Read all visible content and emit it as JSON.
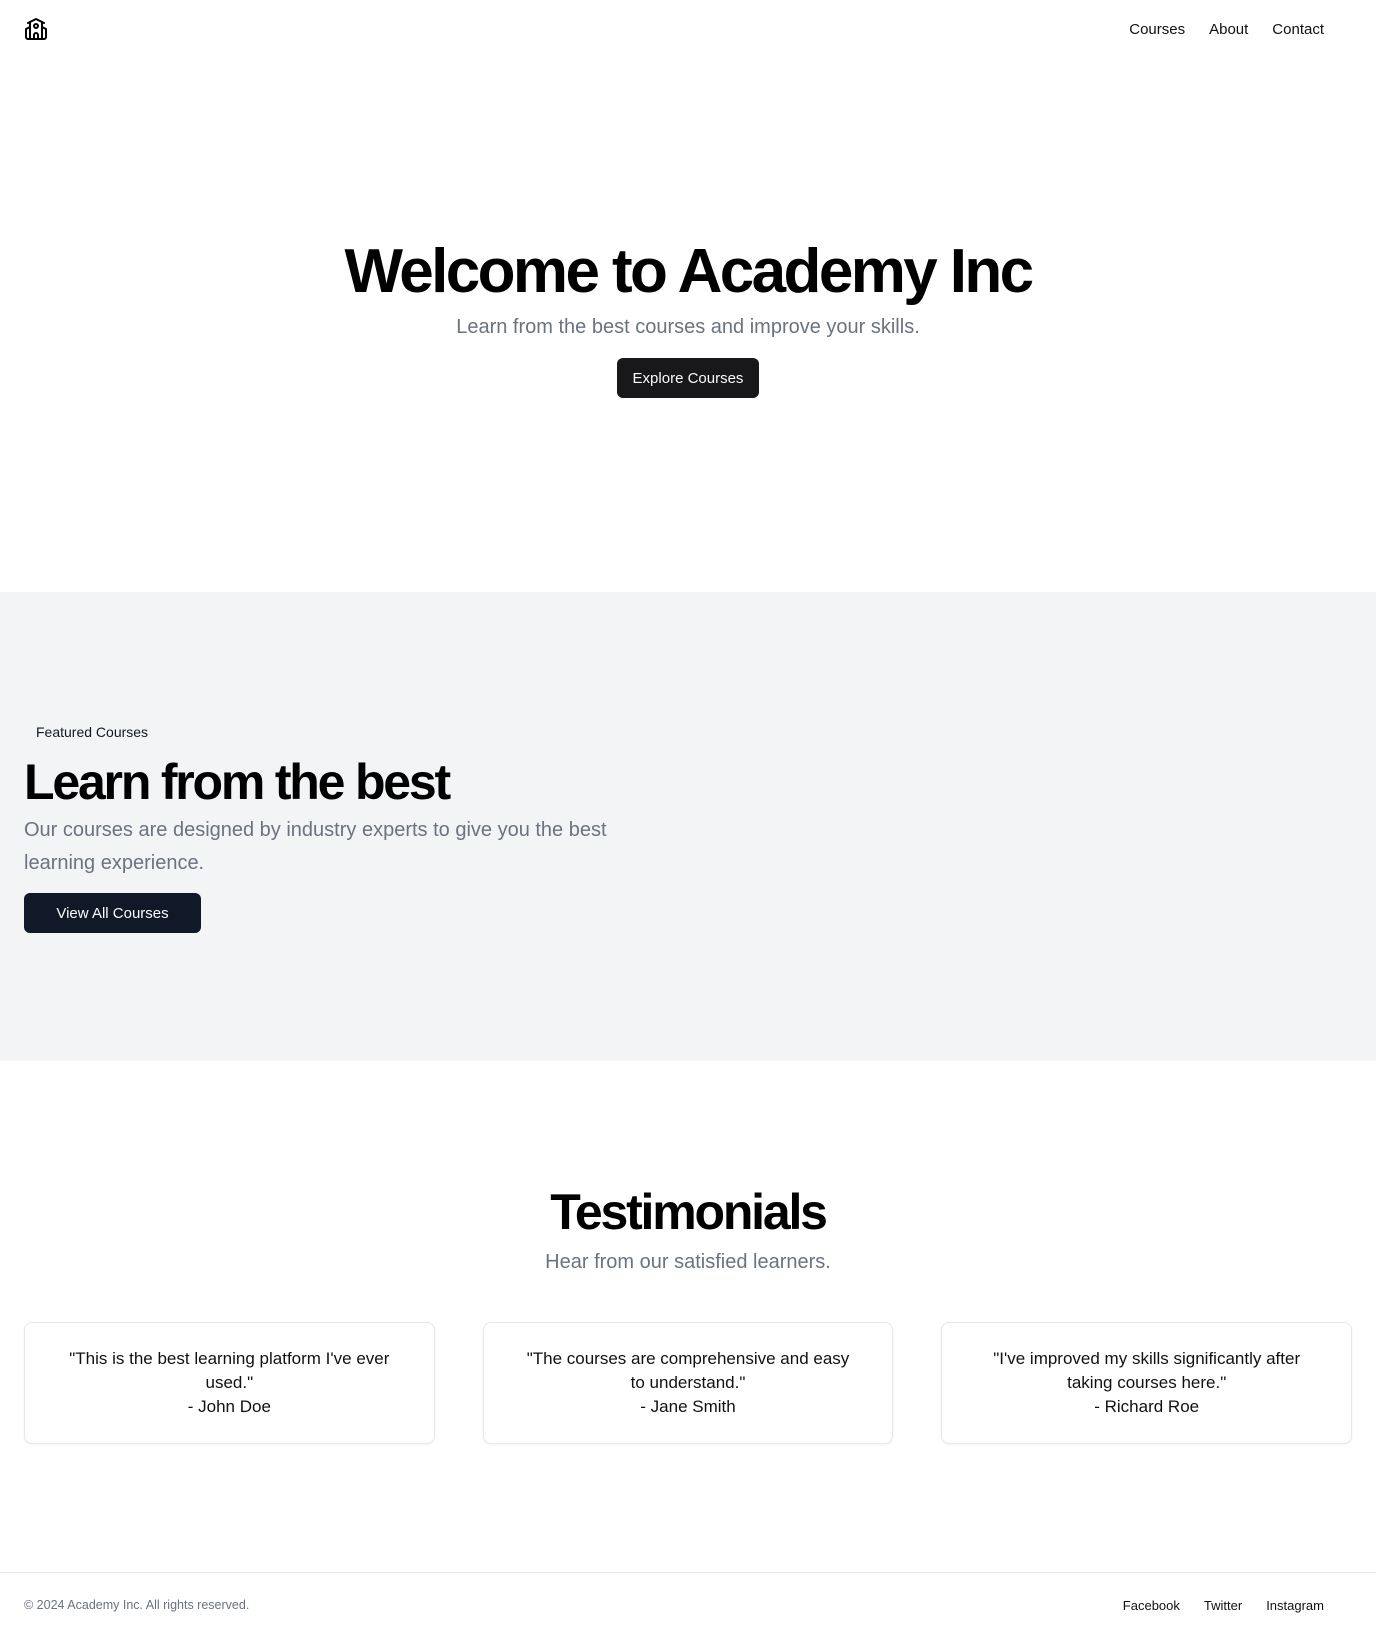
{
  "header": {
    "logo_icon": "school-building-icon",
    "nav": [
      {
        "label": "Courses"
      },
      {
        "label": "About"
      },
      {
        "label": "Contact"
      }
    ]
  },
  "hero": {
    "title": "Welcome to Academy Inc",
    "subtitle": "Learn from the best courses and improve your skills.",
    "cta_label": "Explore Courses"
  },
  "featured": {
    "badge": "Featured Courses",
    "title": "Learn from the best",
    "description": "Our courses are designed by industry experts to give you the best learning experience.",
    "cta_label": "View All Courses"
  },
  "testimonials": {
    "title": "Testimonials",
    "subtitle": "Hear from our satisfied learners.",
    "items": [
      {
        "quote": "\"This is the best learning platform I've ever used.\"",
        "author": "- John Doe"
      },
      {
        "quote": "\"The courses are comprehensive and easy to understand.\"",
        "author": "- Jane Smith"
      },
      {
        "quote": "\"I've improved my skills significantly after taking courses here.\"",
        "author": "- Richard Roe"
      }
    ]
  },
  "footer": {
    "copyright": "© 2024 Academy Inc. All rights reserved.",
    "links": [
      {
        "label": "Facebook"
      },
      {
        "label": "Twitter"
      },
      {
        "label": "Instagram"
      }
    ]
  },
  "colors": {
    "button_dark": "#18181b",
    "section_gray": "#f3f4f6",
    "muted_text": "#6b7280"
  }
}
